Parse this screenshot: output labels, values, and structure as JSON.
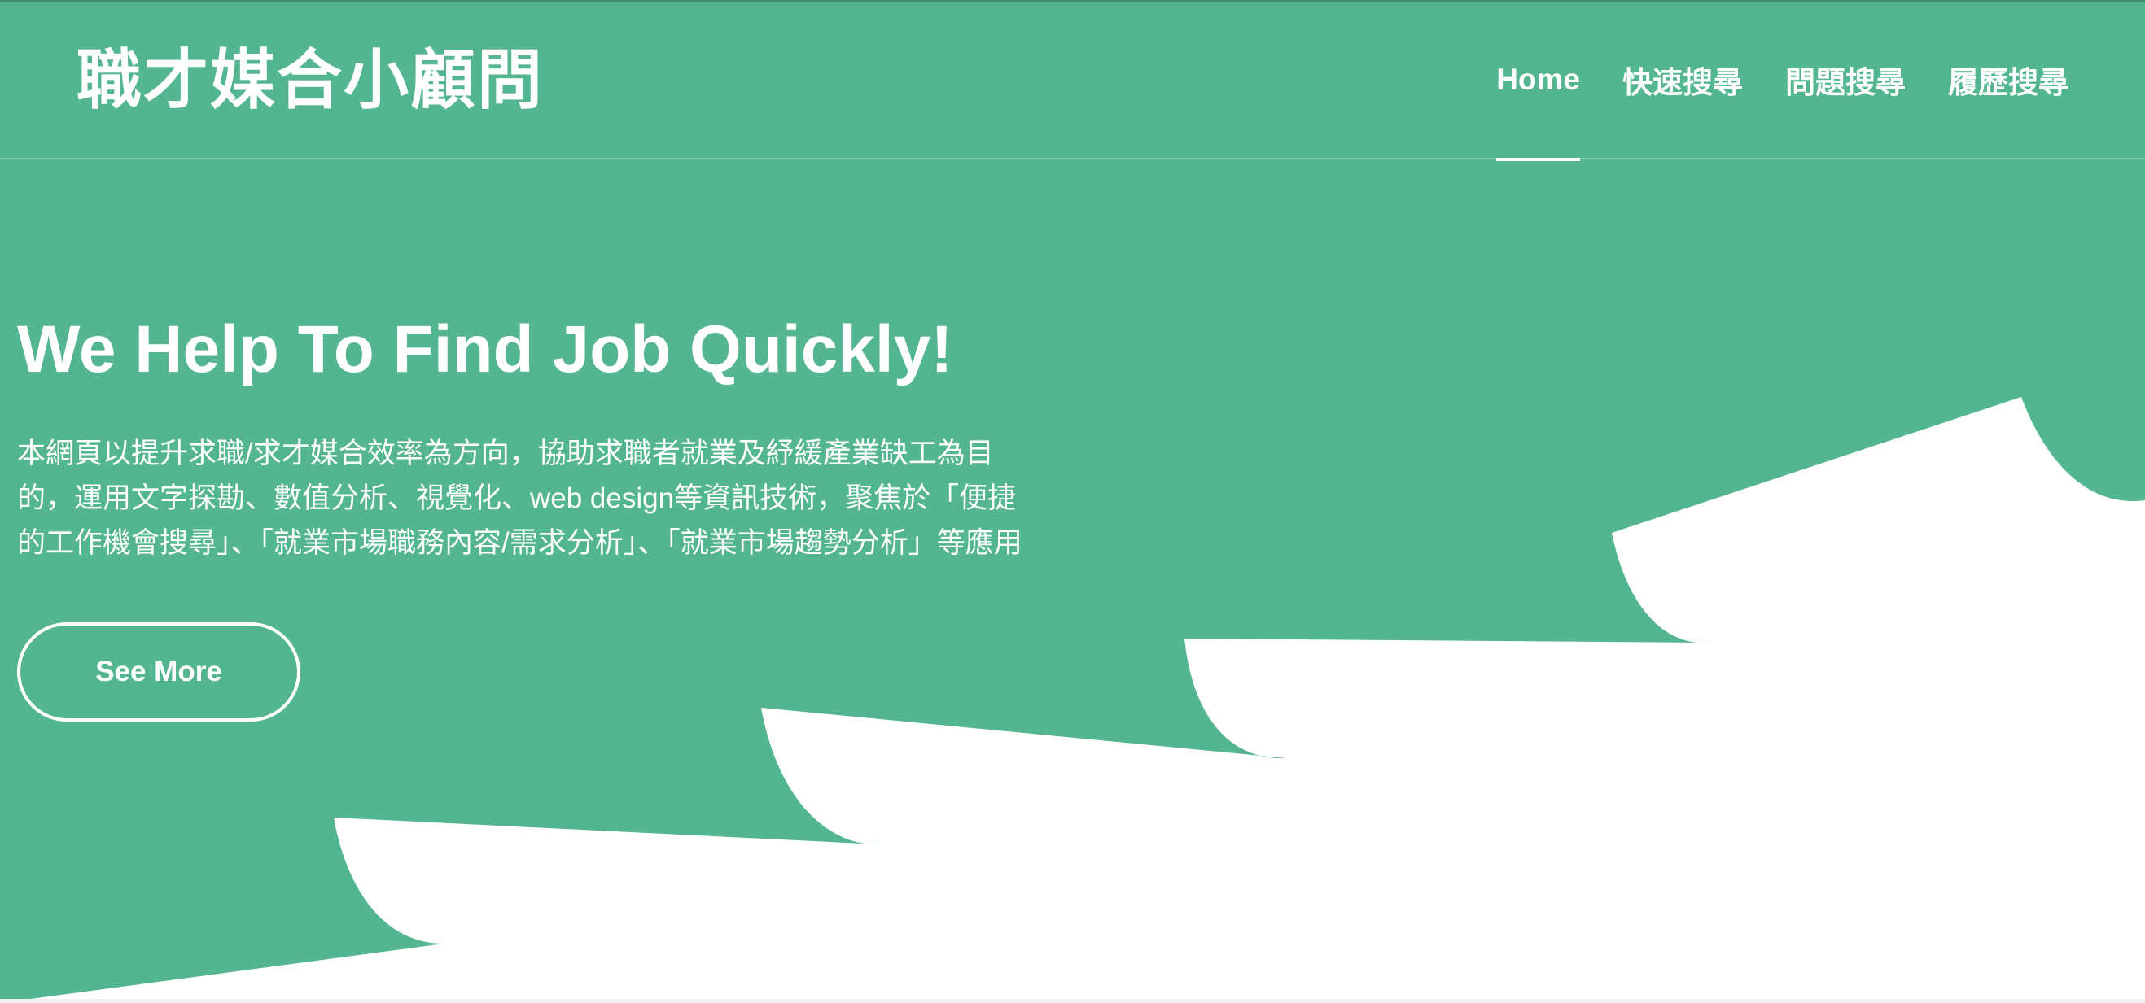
{
  "header": {
    "brand": "職才媒合小顧問",
    "nav": [
      {
        "label": "Home",
        "active": true
      },
      {
        "label": "快速搜尋",
        "active": false
      },
      {
        "label": "問題搜尋",
        "active": false
      },
      {
        "label": "履歷搜尋",
        "active": false
      }
    ]
  },
  "hero": {
    "title": "We Help To Find Job Quickly!",
    "description": "本網頁以提升求職/求才媒合效率為方向，協助求職者就業及紓緩產業缺工為目的，運用文字探勘、數值分析、視覺化、web design等資訊技術，聚焦於「便捷的工作機會搜尋」、「就業市場職務內容/需求分析」、「就業市場趨勢分析」等應用",
    "button_label": "See More"
  },
  "colors": {
    "primary_green": "#54b690",
    "background": "#ffffff",
    "text": "#ffffff"
  }
}
